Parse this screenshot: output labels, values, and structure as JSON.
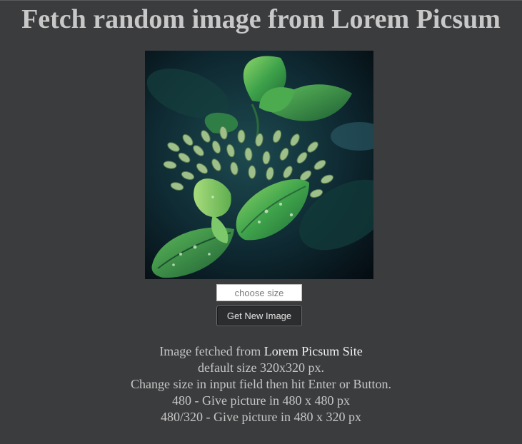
{
  "page": {
    "title": "Fetch random image from Lorem Picsum"
  },
  "image": {
    "description": "close-up photo of green plant leaves with water droplets and flower buds"
  },
  "controls": {
    "size_placeholder": "choose size",
    "size_value": "",
    "button_label": "Get New Image"
  },
  "info": {
    "fetched_prefix": "Image fetched from ",
    "site_link_text": "Lorem Picsum Site",
    "default_size": "default size 320x320 px.",
    "instructions": "Change size in input field then hit Enter or Button.",
    "example_square": "480 - Give picture in 480 x 480 px",
    "example_rect": "480/320 - Give picture in 480 x 320 px"
  },
  "colors": {
    "background": "#3b3c3e",
    "title_text": "#c8c8c8",
    "body_text": "#c6c6c6",
    "link_text": "#f2f2f2",
    "button_bg": "#2c2d2f"
  }
}
